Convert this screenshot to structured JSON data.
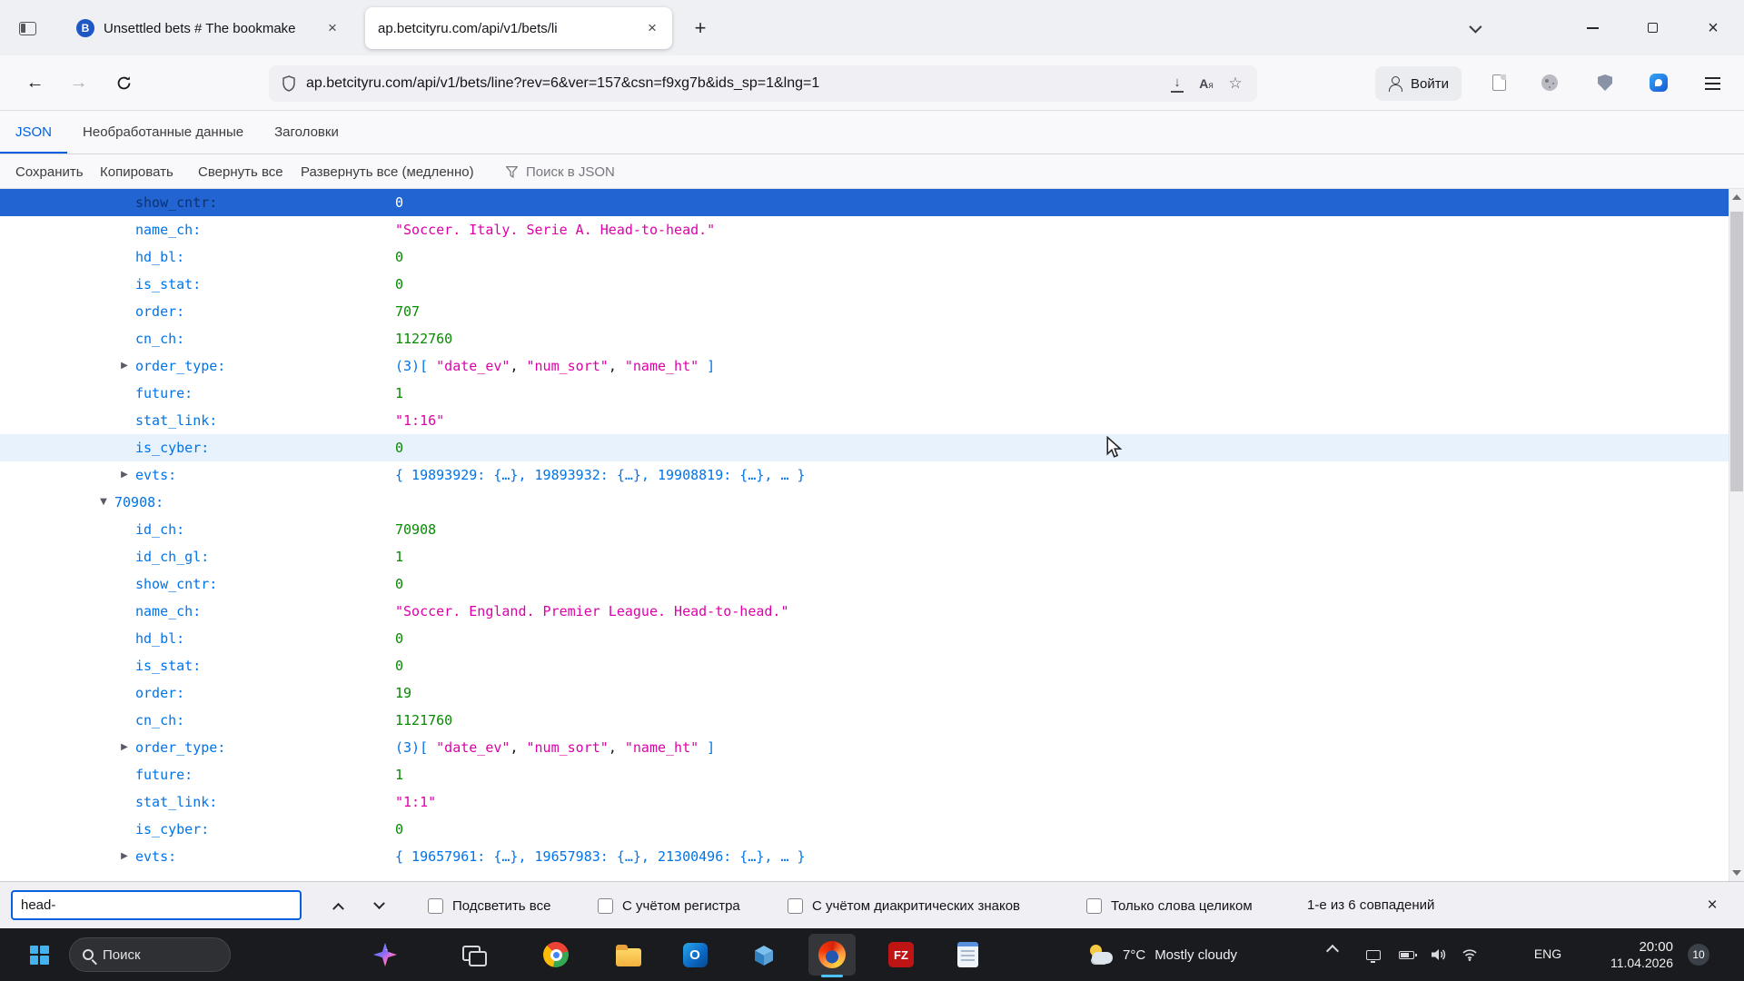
{
  "icons": {
    "close": "×",
    "new_tab": "+",
    "back": "←",
    "forward": "→",
    "star": "☆",
    "download": "↓",
    "collapsed": "▶",
    "expanded": "▼",
    "translate_big": "A",
    "translate_small": "я",
    "tab1_favicon_letter": "B"
  },
  "tabbar": {
    "tab1_title": "Unsettled bets # The bookmake",
    "tab2_title": "ap.betcityru.com/api/v1/bets/li"
  },
  "nav": {
    "url": "ap.betcityru.com/api/v1/bets/line?rev=6&ver=157&csn=f9xg7b&ids_sp=1&lng=1",
    "signin": "Войти"
  },
  "viewer": {
    "tab_json": "JSON",
    "tab_raw": "Необработанные данные",
    "tab_headers": "Заголовки",
    "save": "Сохранить",
    "copy": "Копировать",
    "collapse_all": "Свернуть все",
    "expand_all": "Развернуть все (медленно)",
    "search_placeholder": "Поиск в JSON"
  },
  "tree": {
    "rows": [
      {
        "key": "show_cntr:",
        "value": "0"
      },
      {
        "key": "name_ch:",
        "value": "\"Soccer. Italy. Serie A. Head-to-head.\""
      },
      {
        "key": "hd_bl:",
        "value": "0"
      },
      {
        "key": "is_stat:",
        "value": "0"
      },
      {
        "key": "order:",
        "value": "707"
      },
      {
        "key": "cn_ch:",
        "value": "1122760"
      },
      {
        "key": "order_type:",
        "parts": [
          "(3)[ ",
          "\"date_ev\"",
          ", ",
          "\"num_sort\"",
          ", ",
          "\"name_ht\"",
          " ]"
        ]
      },
      {
        "key": "future:",
        "value": "1"
      },
      {
        "key": "stat_link:",
        "value": "\"1:16\""
      },
      {
        "key": "is_cyber:",
        "value": "0"
      },
      {
        "key": "evts:",
        "value": "{ 19893929: {…}, 19893932: {…}, 19908819: {…}, … }"
      },
      {
        "key": "70908:"
      },
      {
        "key": "id_ch:",
        "value": "70908"
      },
      {
        "key": "id_ch_gl:",
        "value": "1"
      },
      {
        "key": "show_cntr:",
        "value": "0"
      },
      {
        "key": "name_ch:",
        "value": "\"Soccer. England. Premier League. Head-to-head.\""
      },
      {
        "key": "hd_bl:",
        "value": "0"
      },
      {
        "key": "is_stat:",
        "value": "0"
      },
      {
        "key": "order:",
        "value": "19"
      },
      {
        "key": "cn_ch:",
        "value": "1121760"
      },
      {
        "key": "order_type:",
        "parts": [
          "(3)[ ",
          "\"date_ev\"",
          ", ",
          "\"num_sort\"",
          ", ",
          "\"name_ht\"",
          " ]"
        ]
      },
      {
        "key": "future:",
        "value": "1"
      },
      {
        "key": "stat_link:",
        "value": "\"1:1\""
      },
      {
        "key": "is_cyber:",
        "value": "0"
      },
      {
        "key": "evts:",
        "value": "{ 19657961: {…}, 19657983: {…}, 21300496: {…}, … }"
      }
    ]
  },
  "findbar": {
    "query": "head-",
    "highlight_all": "Подсветить все",
    "match_case": "С учётом регистра",
    "match_diacritics": "С учётом диакритических знаков",
    "whole_words": "Только слова целиком",
    "status": "1-е из 6 совпадений"
  },
  "taskbar": {
    "search": "Поиск",
    "weather_temp": "7°C",
    "weather_condition": "Mostly cloudy",
    "language": "ENG",
    "time": "20:00",
    "date": "11.04.2026",
    "notification_count": "10",
    "outlook_letter": "O",
    "filezilla_letters": "FZ"
  }
}
